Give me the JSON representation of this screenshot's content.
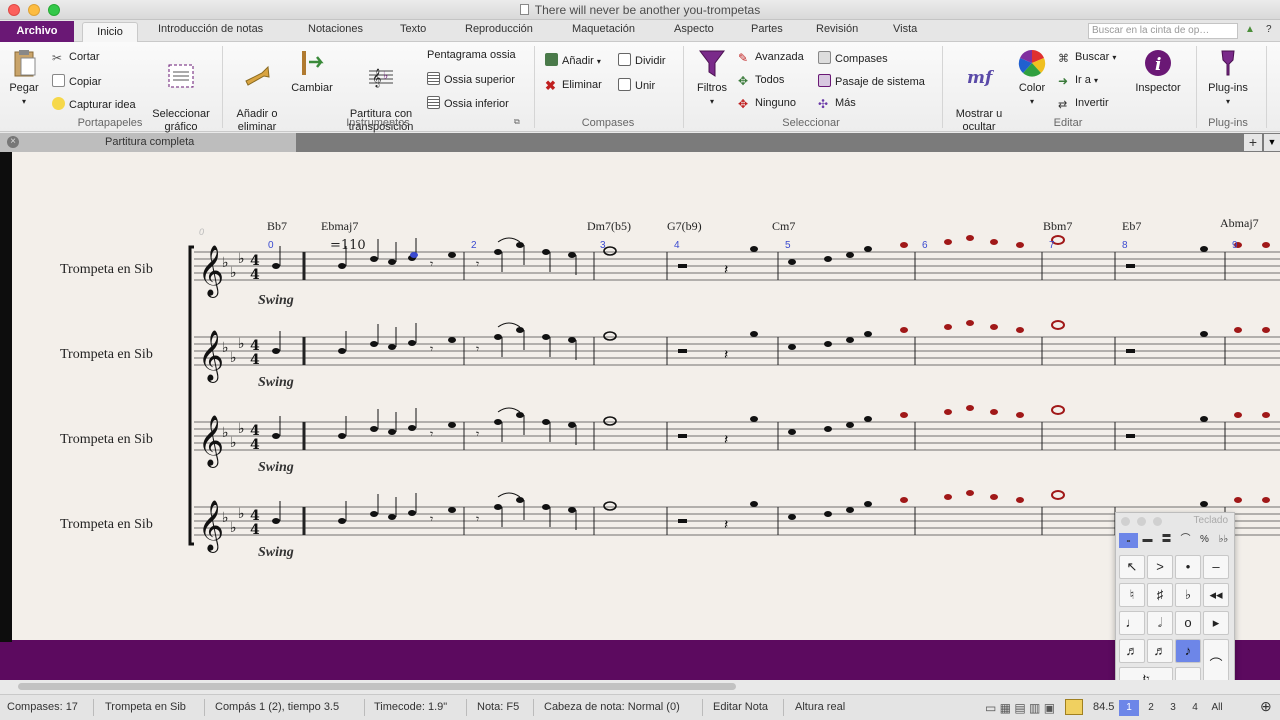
{
  "window": {
    "title": "There will never be another you-trompetas"
  },
  "ribbon_tabs": {
    "archivo": "Archivo",
    "inicio": "Inicio",
    "items": [
      "Introducción de notas",
      "Notaciones",
      "Texto",
      "Reproducción",
      "Maquetación",
      "Aspecto",
      "Partes",
      "Revisión",
      "Vista"
    ],
    "search_placeholder": "Buscar en la cinta de op…"
  },
  "ribbon": {
    "portapapeles": {
      "pegar": "Pegar",
      "cortar": "Cortar",
      "copiar": "Copiar",
      "capturar": "Capturar idea",
      "seleccionar_grafico": "Seleccionar\ngráfico",
      "label": "Portapapeles"
    },
    "instrumentos": {
      "anadir": "Añadir o\neliminar",
      "cambiar": "Cambiar",
      "partitura": "Partitura con\ntransposición",
      "pentagrama_ossia": "Pentagrama ossia",
      "ossia_superior": "Ossia superior",
      "ossia_inferior": "Ossia inferior",
      "label": "Instrumentos"
    },
    "compases": {
      "anadir": "Añadir",
      "dividir": "Dividir",
      "eliminar": "Eliminar",
      "unir": "Unir",
      "label": "Compases"
    },
    "seleccionar": {
      "filtros": "Filtros",
      "avanzada": "Avanzada",
      "todos": "Todos",
      "ninguno": "Ninguno",
      "compases": "Compases",
      "pasaje": "Pasaje de sistema",
      "mas": "Más",
      "label": "Seleccionar"
    },
    "editar": {
      "mostrar": "Mostrar u\nocultar",
      "color": "Color",
      "buscar": "Buscar",
      "ira": "Ir a",
      "invertir": "Invertir",
      "inspector": "Inspector",
      "label": "Editar"
    },
    "plugins": {
      "plugins": "Plug-ins",
      "label": "Plug-ins"
    }
  },
  "doc_tab": {
    "label": "Partitura completa"
  },
  "score": {
    "instrument_names": [
      "Trompeta en Sib",
      "Trompeta en Sib",
      "Trompeta en Sib",
      "Trompeta en Sib"
    ],
    "style_marks": [
      "Swing",
      "Swing",
      "Swing",
      "Swing"
    ],
    "tempo": "=110",
    "measure_zero": "0",
    "chords": [
      "Bb7",
      "Ebmaj7",
      "Dm7(b5)",
      "G7(b9)",
      "Cm7",
      "Bbm7",
      "Eb7",
      "Abmaj7"
    ],
    "bar_numbers": [
      "0",
      "2",
      "3",
      "4",
      "5",
      "6",
      "7",
      "8",
      "9"
    ],
    "time_signature": "4/4"
  },
  "status": {
    "compases": "Compases: 17",
    "instrumento": "Trompeta en Sib",
    "compas": "Compás 1 (2), tiempo 3.5",
    "timecode": "Timecode: 1.9\"",
    "nota": "Nota: F5",
    "cabeza": "Cabeza de nota: Normal (0)",
    "editar_nota": "Editar Nota",
    "altura": "Altura real",
    "zoom": "84.5"
  },
  "keypad": {
    "title": "Teclado",
    "layers": [
      "1",
      "2",
      "3",
      "4",
      "All"
    ]
  },
  "colors": {
    "archivo": "#6a1875",
    "score_bg": "#5c0a5f",
    "paper": "#f3efea",
    "selected": "#6d86e8",
    "red_note": "#a01818"
  }
}
